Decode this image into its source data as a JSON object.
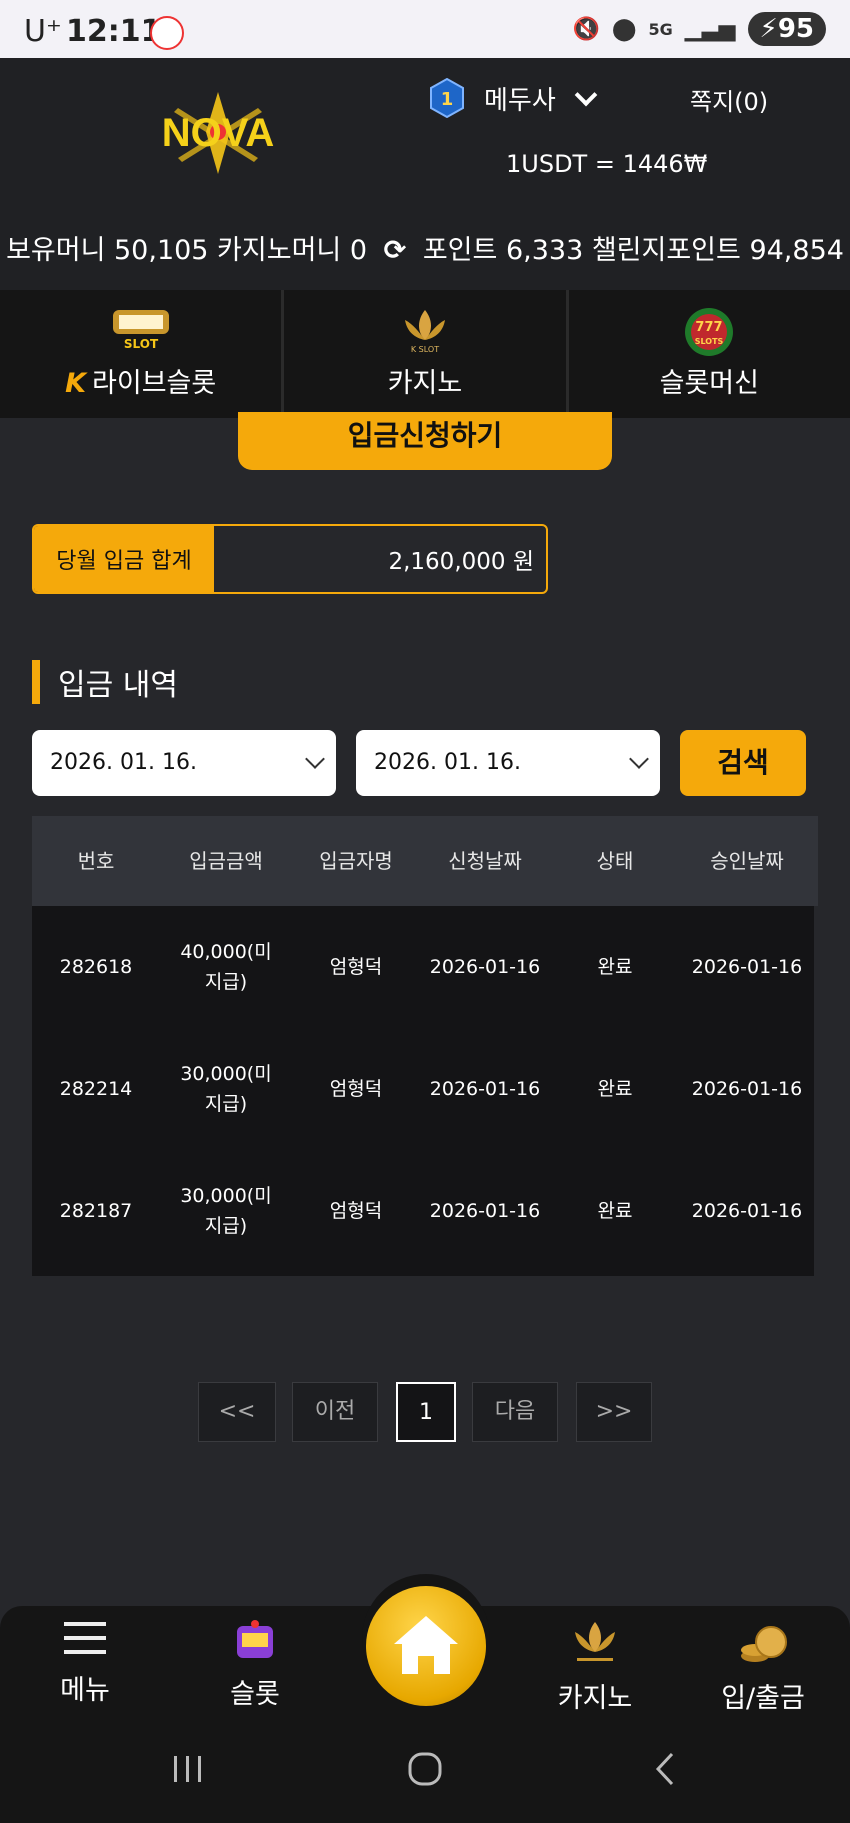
{
  "status_bar": {
    "carrier": "U⁺",
    "time": "12:11",
    "battery": "95",
    "net": "5G"
  },
  "header": {
    "brand": "NOVA",
    "rank": "1",
    "username": "메두사",
    "messages": "쪽지(0)",
    "rate": "1USDT = 1446₩",
    "money_line": "보유머니 50,105 카지노머니 0",
    "points_line": "포인트 6,333 챌린지포인트 94,854"
  },
  "categories": [
    {
      "label": "라이브슬롯",
      "icon_text": "SLOT",
      "prefix": "K"
    },
    {
      "label": "카지노",
      "icon_text": "K SLOT"
    },
    {
      "label": "슬롯머신",
      "icon_text": "SLOTS"
    }
  ],
  "deposit": {
    "request_button": "입금신청하기",
    "monthly_label": "당월 입금 합계",
    "monthly_value": "2,160,000 원"
  },
  "history": {
    "title": "입금 내역",
    "date_from": "2026. 01. 16.",
    "date_to": "2026. 01. 16.",
    "search_button": "검색",
    "columns": [
      "번호",
      "입금금액",
      "입금자명",
      "신청날짜",
      "상태",
      "승인날짜"
    ],
    "rows": [
      [
        "282618",
        "40,000(미지급)",
        "엄형덕",
        "2026-01-16",
        "완료",
        "2026-01-16"
      ],
      [
        "282214",
        "30,000(미지급)",
        "엄형덕",
        "2026-01-16",
        "완료",
        "2026-01-16"
      ],
      [
        "282187",
        "30,000(미지급)",
        "엄형덕",
        "2026-01-16",
        "완료",
        "2026-01-16"
      ]
    ]
  },
  "pagination": {
    "first": "<<",
    "prev": "이전",
    "current": "1",
    "next": "다음",
    "last": ">>"
  },
  "bottom_nav": {
    "menu": "메뉴",
    "slot": "슬롯",
    "casino": "카지노",
    "bank": "입/출금"
  },
  "colors": {
    "accent": "#f5a90b",
    "background": "#26272b",
    "header": "#202124"
  }
}
